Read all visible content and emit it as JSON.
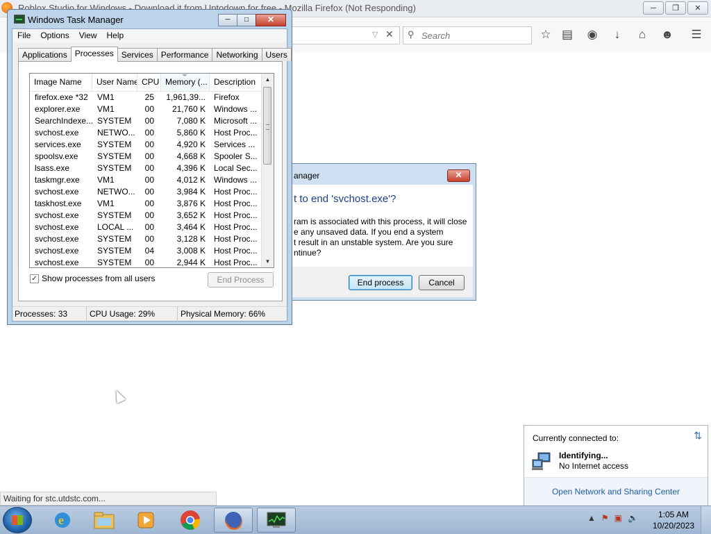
{
  "firefox": {
    "window_title": "Roblox Studio for Windows - Download it from Uptodown for free - Mozilla Firefox (Not Responding)",
    "search_placeholder": "Search",
    "status_text": "Waiting for stc.utdstc.com...",
    "toolbar_icons": [
      "star-icon",
      "reading-list-icon",
      "pocket-icon",
      "download-icon",
      "home-icon",
      "chat-icon",
      "menu-icon"
    ]
  },
  "taskmgr": {
    "title": "Windows Task Manager",
    "menu": [
      "File",
      "Options",
      "View",
      "Help"
    ],
    "tabs": [
      "Applications",
      "Processes",
      "Services",
      "Performance",
      "Networking",
      "Users"
    ],
    "active_tab": "Processes",
    "columns": [
      "Image Name",
      "User Name",
      "CPU",
      "Memory (...",
      "Description"
    ],
    "rows": [
      [
        "firefox.exe *32",
        "VM1",
        "25",
        "1,961,39...",
        "Firefox"
      ],
      [
        "explorer.exe",
        "VM1",
        "00",
        "21,760 K",
        "Windows ..."
      ],
      [
        "SearchIndexe...",
        "SYSTEM",
        "00",
        "7,080 K",
        "Microsoft ..."
      ],
      [
        "svchost.exe",
        "NETWO...",
        "00",
        "5,860 K",
        "Host Proc..."
      ],
      [
        "services.exe",
        "SYSTEM",
        "00",
        "4,920 K",
        "Services ..."
      ],
      [
        "spoolsv.exe",
        "SYSTEM",
        "00",
        "4,668 K",
        "Spooler S..."
      ],
      [
        "lsass.exe",
        "SYSTEM",
        "00",
        "4,396 K",
        "Local Sec..."
      ],
      [
        "taskmgr.exe",
        "VM1",
        "00",
        "4,012 K",
        "Windows ..."
      ],
      [
        "svchost.exe",
        "NETWO...",
        "00",
        "3,984 K",
        "Host Proc..."
      ],
      [
        "taskhost.exe",
        "VM1",
        "00",
        "3,876 K",
        "Host Proc..."
      ],
      [
        "svchost.exe",
        "SYSTEM",
        "00",
        "3,652 K",
        "Host Proc..."
      ],
      [
        "svchost.exe",
        "LOCAL ...",
        "00",
        "3,464 K",
        "Host Proc..."
      ],
      [
        "svchost.exe",
        "SYSTEM",
        "00",
        "3,128 K",
        "Host Proc..."
      ],
      [
        "svchost.exe",
        "SYSTEM",
        "04",
        "3,008 K",
        "Host Proc..."
      ],
      [
        "svchost.exe",
        "SYSTEM",
        "00",
        "2,944 K",
        "Host Proc..."
      ]
    ],
    "show_all_label": "Show processes from all users",
    "show_all_checked": true,
    "end_process_label": "End Process",
    "status": {
      "processes": "Processes: 33",
      "cpu": "CPU Usage: 29%",
      "memory": "Physical Memory: 66%"
    }
  },
  "dialog": {
    "title_visible": "anager",
    "heading_visible": "t to end 'svchost.exe'?",
    "message_lines": [
      "ram is associated with this process, it will close",
      "e any unsaved data. If you end a system",
      "t result in an unstable system. Are you sure",
      "ntinue?"
    ],
    "end_button": "End process",
    "cancel_button": "Cancel"
  },
  "network": {
    "header": "Currently connected to:",
    "network_name": "Identifying...",
    "network_state": "No Internet access",
    "link": "Open Network and Sharing Center"
  },
  "taskbar": {
    "apps": [
      "internet-explorer-icon",
      "windows-explorer-icon",
      "media-player-icon",
      "chrome-icon",
      "firefox-icon",
      "task-manager-icon"
    ],
    "time": "1:05 AM",
    "date": "10/20/2023"
  }
}
